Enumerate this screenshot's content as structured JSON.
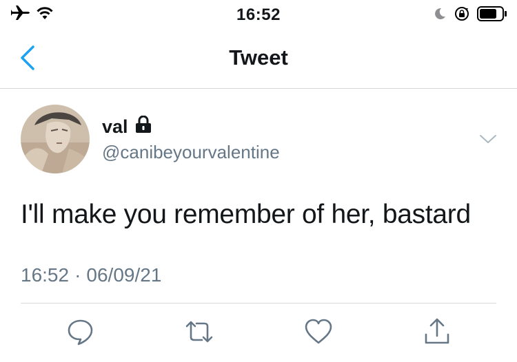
{
  "status_bar": {
    "time": "16:52",
    "left_icons": [
      "airplane-icon",
      "wifi-icon"
    ],
    "right_icons": [
      "moon-icon",
      "rotation-lock-icon",
      "battery-icon"
    ]
  },
  "nav": {
    "title": "Tweet",
    "back_icon": "chevron-left-icon"
  },
  "tweet": {
    "display_name": "val",
    "protected_icon": "lock-icon",
    "handle": "@canibeyourvalentine",
    "text": "I'll make you remember of her, bastard",
    "time": "16:52",
    "separator": "·",
    "date": "06/09/21"
  },
  "actions": [
    "reply-icon",
    "retweet-icon",
    "like-icon",
    "share-icon"
  ],
  "colors": {
    "accent": "#1da1f2",
    "text": "#14171a",
    "secondary": "#657786",
    "divider": "#d9d9d9"
  }
}
